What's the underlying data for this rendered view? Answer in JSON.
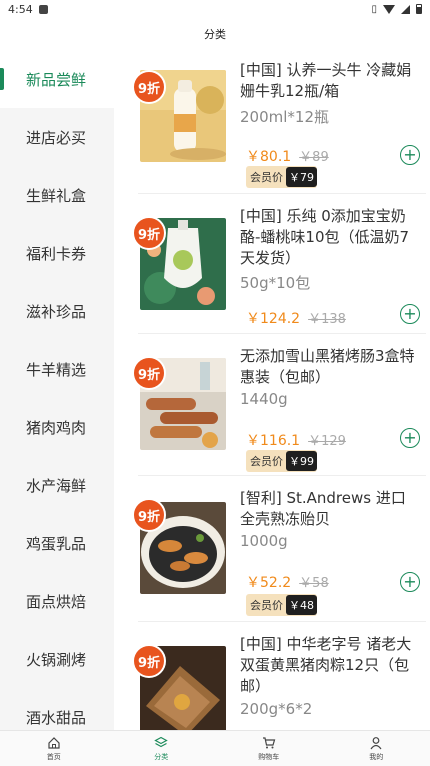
{
  "status": {
    "time": "4:54"
  },
  "header": {
    "title": "分类"
  },
  "sidebar": {
    "items": [
      {
        "label": "新品尝鲜"
      },
      {
        "label": "进店必买"
      },
      {
        "label": "生鲜礼盒"
      },
      {
        "label": "福利卡券"
      },
      {
        "label": "滋补珍品"
      },
      {
        "label": "牛羊精选"
      },
      {
        "label": "猪肉鸡肉"
      },
      {
        "label": "水产海鲜"
      },
      {
        "label": "鸡蛋乳品"
      },
      {
        "label": "面点烘焙"
      },
      {
        "label": "火锅涮烤"
      },
      {
        "label": "酒水甜品"
      }
    ]
  },
  "products": [
    {
      "badge": "9折",
      "name": "[中国] 认养一头牛 冷藏娟姗牛乳12瓶/箱",
      "spec": "200ml*12瓶",
      "price": "￥80.1",
      "original": "￥89",
      "member_label": "会员价",
      "member_price": "￥79"
    },
    {
      "badge": "9折",
      "name": "[中国] 乐纯 0添加宝宝奶酪-蟠桃味10包（低温奶7天发货）",
      "spec": "50g*10包",
      "price": "￥124.2",
      "original": "￥138"
    },
    {
      "badge": "9折",
      "name": "无添加雪山黑猪烤肠3盒特惠装（包邮）",
      "spec": "1440g",
      "price": "￥116.1",
      "original": "￥129",
      "member_label": "会员价",
      "member_price": "￥99"
    },
    {
      "badge": "9折",
      "name": "[智利] St.Andrews 进口全壳熟冻贻贝",
      "spec": "1000g",
      "price": "￥52.2",
      "original": "￥58",
      "member_label": "会员价",
      "member_price": "￥48"
    },
    {
      "badge": "9折",
      "name": "[中国] 中华老字号 诸老大双蛋黄黑猪肉粽12只（包邮）",
      "spec": "200g*6*2"
    }
  ],
  "tabbar": {
    "items": [
      {
        "label": "首页"
      },
      {
        "label": "分类"
      },
      {
        "label": "购物车"
      },
      {
        "label": "我的"
      }
    ]
  },
  "colors": {
    "accent": "#1b8a5a",
    "price": "#f08a1b",
    "badge": "#e8541e"
  }
}
